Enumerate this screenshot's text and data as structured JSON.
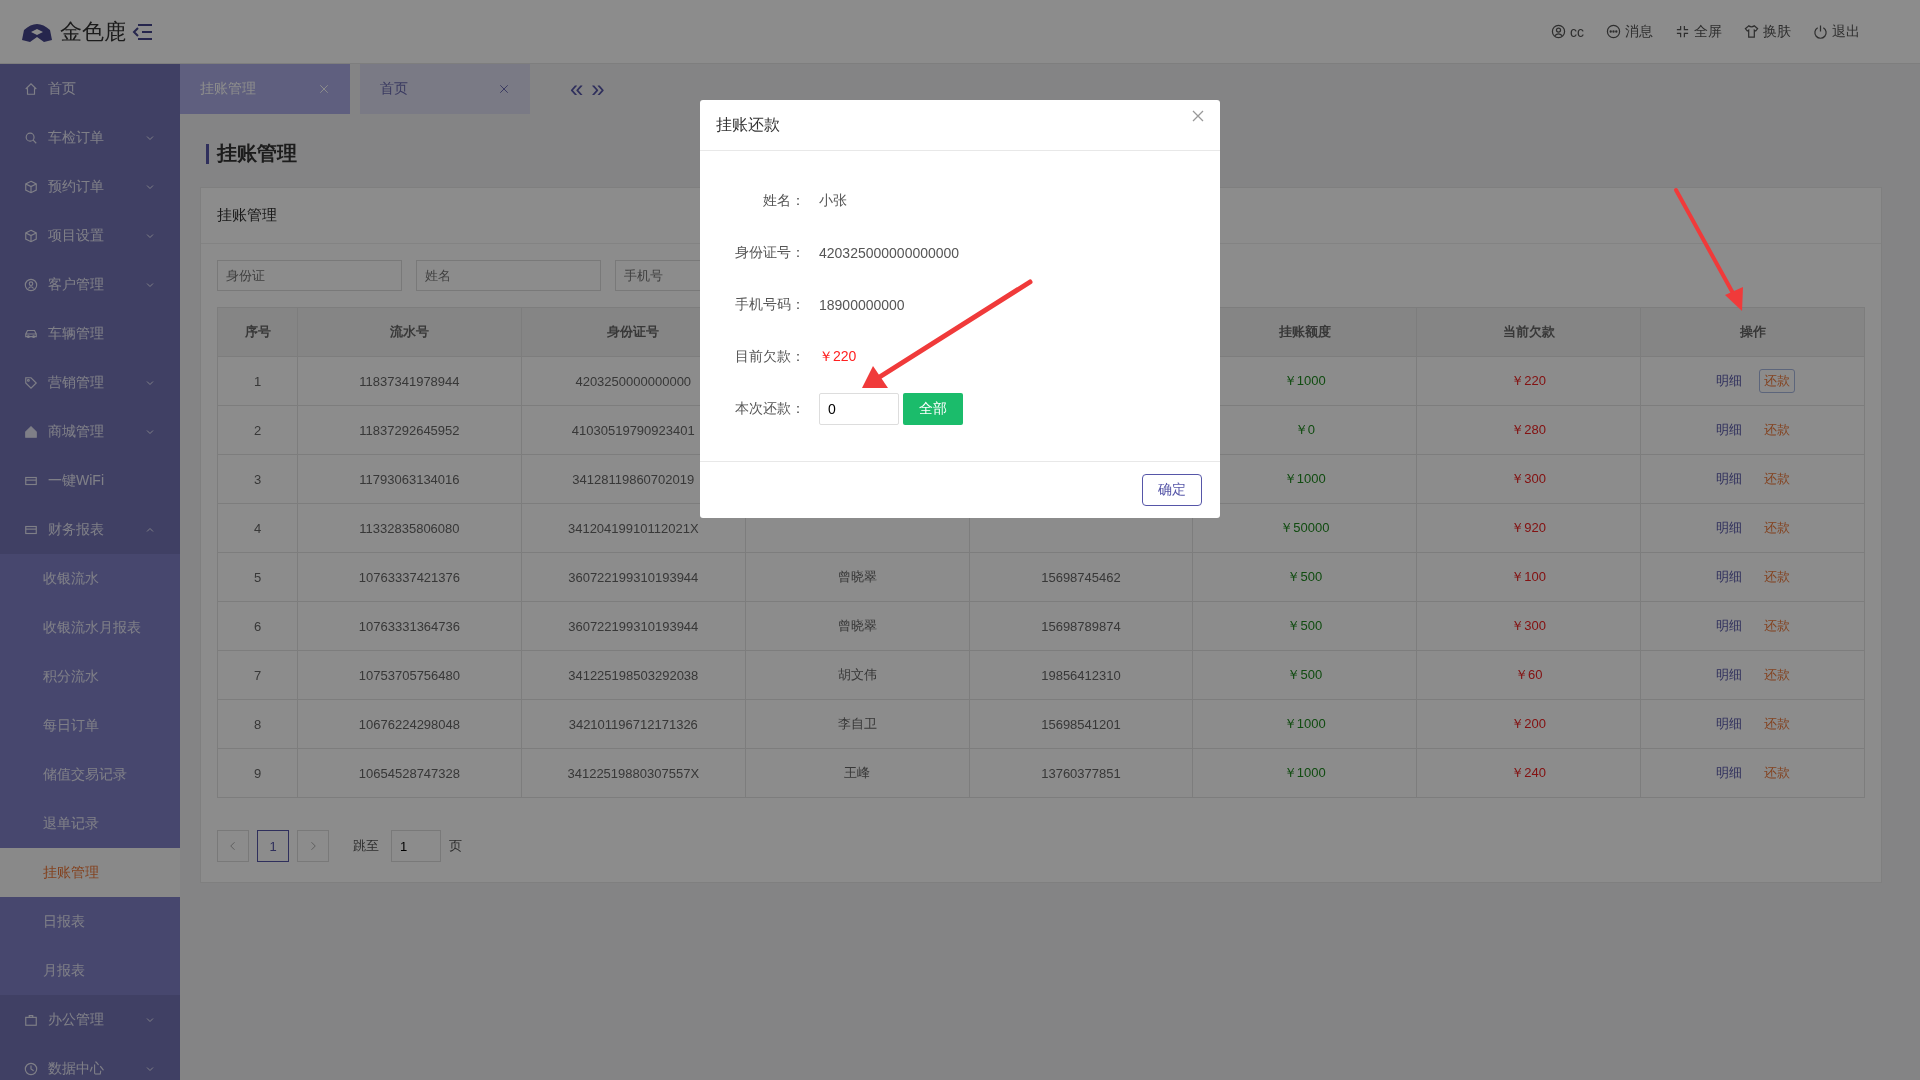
{
  "header": {
    "logo_text": "金色鹿",
    "actions": [
      {
        "label": "cc"
      },
      {
        "label": "消息"
      },
      {
        "label": "全屏"
      },
      {
        "label": "换肤"
      },
      {
        "label": "退出"
      }
    ]
  },
  "sidebar": {
    "items": [
      {
        "label": "首页",
        "kind": "link",
        "selected": false
      },
      {
        "label": "车检订单",
        "kind": "group",
        "expanded": false,
        "selected": false
      },
      {
        "label": "预约订单",
        "kind": "group",
        "expanded": false,
        "selected": false
      },
      {
        "label": "项目设置",
        "kind": "group",
        "expanded": false,
        "selected": false
      },
      {
        "label": "客户管理",
        "kind": "group",
        "expanded": false,
        "selected": false
      },
      {
        "label": "车辆管理",
        "kind": "link",
        "selected": false
      },
      {
        "label": "营销管理",
        "kind": "group",
        "expanded": false,
        "selected": false
      },
      {
        "label": "商城管理",
        "kind": "group",
        "expanded": false,
        "selected": false
      },
      {
        "label": "一键WiFi",
        "kind": "link",
        "selected": false
      },
      {
        "label": "财务报表",
        "kind": "group",
        "expanded": true,
        "selected": false,
        "children": [
          {
            "label": "收银流水",
            "selected": false
          },
          {
            "label": "收银流水月报表",
            "selected": false
          },
          {
            "label": "积分流水",
            "selected": false
          },
          {
            "label": "每日订单",
            "selected": false
          },
          {
            "label": "储值交易记录",
            "selected": false
          },
          {
            "label": "退单记录",
            "selected": false
          },
          {
            "label": "挂账管理",
            "selected": true
          },
          {
            "label": "日报表",
            "selected": false
          },
          {
            "label": "月报表",
            "selected": false
          }
        ]
      },
      {
        "label": "办公管理",
        "kind": "group",
        "expanded": false,
        "selected": false
      },
      {
        "label": "数据中心",
        "kind": "group",
        "expanded": false,
        "selected": false
      }
    ]
  },
  "tabs": [
    {
      "label": "挂账管理",
      "selected": true
    },
    {
      "label": "首页",
      "selected": false
    }
  ],
  "tab_scroll": {
    "prev": "«",
    "next": "»"
  },
  "page_title": "挂账管理",
  "card": {
    "title": "挂账管理",
    "filters": [
      {
        "placeholder": "身份证"
      },
      {
        "placeholder": "姓名"
      },
      {
        "placeholder": "手机号"
      }
    ],
    "table": {
      "columns": [
        "序号",
        "流水号",
        "身份证号",
        "",
        "",
        "挂账额度",
        "当前欠款",
        "操作"
      ],
      "rows": [
        {
          "seq": "1",
          "serial": "11837341978944",
          "id_number": "4203250000000000",
          "limit": "￥1000",
          "debt": "￥220",
          "actions": [
            {
              "label": "明细"
            },
            {
              "label": "还款"
            }
          ],
          "focused": true
        },
        {
          "seq": "2",
          "serial": "11837292645952",
          "id_number": "41030519790923401",
          "limit": "￥0",
          "debt": "￥280",
          "actions": [
            {
              "label": "明细"
            },
            {
              "label": "还款"
            }
          ],
          "focused": false
        },
        {
          "seq": "3",
          "serial": "11793063134016",
          "id_number": "34128119860702019",
          "limit": "￥1000",
          "debt": "￥300",
          "actions": [
            {
              "label": "明细"
            },
            {
              "label": "还款"
            }
          ],
          "focused": false
        },
        {
          "seq": "4",
          "serial": "11332835806080",
          "id_number": "34120419910112021X",
          "limit": "￥50000",
          "debt": "￥920",
          "actions": [
            {
              "label": "明细"
            },
            {
              "label": "还款"
            }
          ],
          "focused": false
        },
        {
          "seq": "5",
          "serial": "10763337421376",
          "id_number": "360722199310193944",
          "name": "曾晓翠",
          "phone": "15698745462",
          "limit": "￥500",
          "debt": "￥100",
          "actions": [
            {
              "label": "明细"
            },
            {
              "label": "还款"
            }
          ],
          "focused": false
        },
        {
          "seq": "6",
          "serial": "10763331364736",
          "id_number": "360722199310193944",
          "name": "曾晓翠",
          "phone": "15698789874",
          "limit": "￥500",
          "debt": "￥300",
          "actions": [
            {
              "label": "明细"
            },
            {
              "label": "还款"
            }
          ],
          "focused": false
        },
        {
          "seq": "7",
          "serial": "10753705756480",
          "id_number": "341225198503292038",
          "name": "胡文伟",
          "phone": "19856412310",
          "limit": "￥500",
          "debt": "￥60",
          "actions": [
            {
              "label": "明细"
            },
            {
              "label": "还款"
            }
          ],
          "focused": false
        },
        {
          "seq": "8",
          "serial": "10676224298048",
          "id_number": "342101196712171326",
          "name": "李自卫",
          "phone": "15698541201",
          "limit": "￥1000",
          "debt": "￥200",
          "actions": [
            {
              "label": "明细"
            },
            {
              "label": "还款"
            }
          ],
          "focused": false
        },
        {
          "seq": "9",
          "serial": "10654528747328",
          "id_number": "34122519880307557X",
          "name": "王峰",
          "phone": "13760377851",
          "limit": "￥1000",
          "debt": "￥240",
          "actions": [
            {
              "label": "明细"
            },
            {
              "label": "还款"
            }
          ],
          "focused": false
        }
      ]
    },
    "pagination": {
      "pages": [
        {
          "label": "1",
          "selected": true
        }
      ],
      "jump_label": "跳至",
      "jump_value": "1",
      "page_unit": "页"
    }
  },
  "modal": {
    "title": "挂账还款",
    "fields": [
      {
        "label": "姓名：",
        "value": "小张",
        "kind": "text"
      },
      {
        "label": "身份证号：",
        "value": "420325000000000000",
        "kind": "text"
      },
      {
        "label": "手机号码：",
        "value": "18900000000",
        "kind": "text"
      },
      {
        "label": "目前欠款：",
        "value": "￥220",
        "kind": "amount"
      },
      {
        "label": "本次还款：",
        "value": "0",
        "kind": "input",
        "button": "全部"
      }
    ],
    "confirm": "确定"
  }
}
